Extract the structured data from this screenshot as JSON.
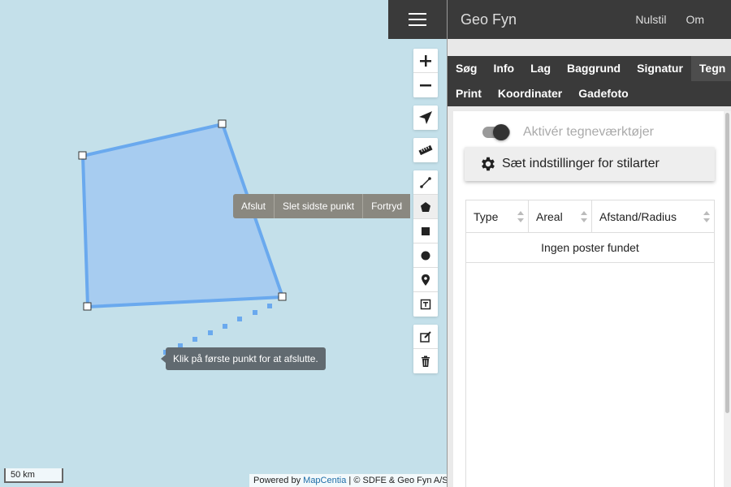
{
  "map": {
    "draw_bar": {
      "finish": "Afslut",
      "delete_last": "Slet sidste punkt",
      "undo": "Fortryd"
    },
    "tooltip": "Klik på første punkt for at afslutte.",
    "scale": "50 km",
    "attribution": {
      "prefix": "Powered by",
      "link": "MapCentia",
      "suffix": "| © SDFE & Geo Fyn A/S"
    },
    "polygon_fill": "#a7ccf0",
    "polygon_stroke": "#6aa9ee"
  },
  "header": {
    "title": "Geo Fyn",
    "reset": "Nulstil",
    "about": "Om"
  },
  "tabs": {
    "row1": [
      "Søg",
      "Info",
      "Lag",
      "Baggrund",
      "Signatur",
      "Tegn"
    ],
    "row2": [
      "Print",
      "Koordinater",
      "Gadefoto"
    ],
    "active": "Tegn"
  },
  "draw_panel": {
    "toggle_label": "Aktivér tegneværktøjer",
    "style_button": "Sæt indstillinger for stilarter",
    "table": {
      "columns": [
        "Type",
        "Areal",
        "Afstand/Radius"
      ],
      "empty_text": "Ingen poster fundet"
    }
  }
}
